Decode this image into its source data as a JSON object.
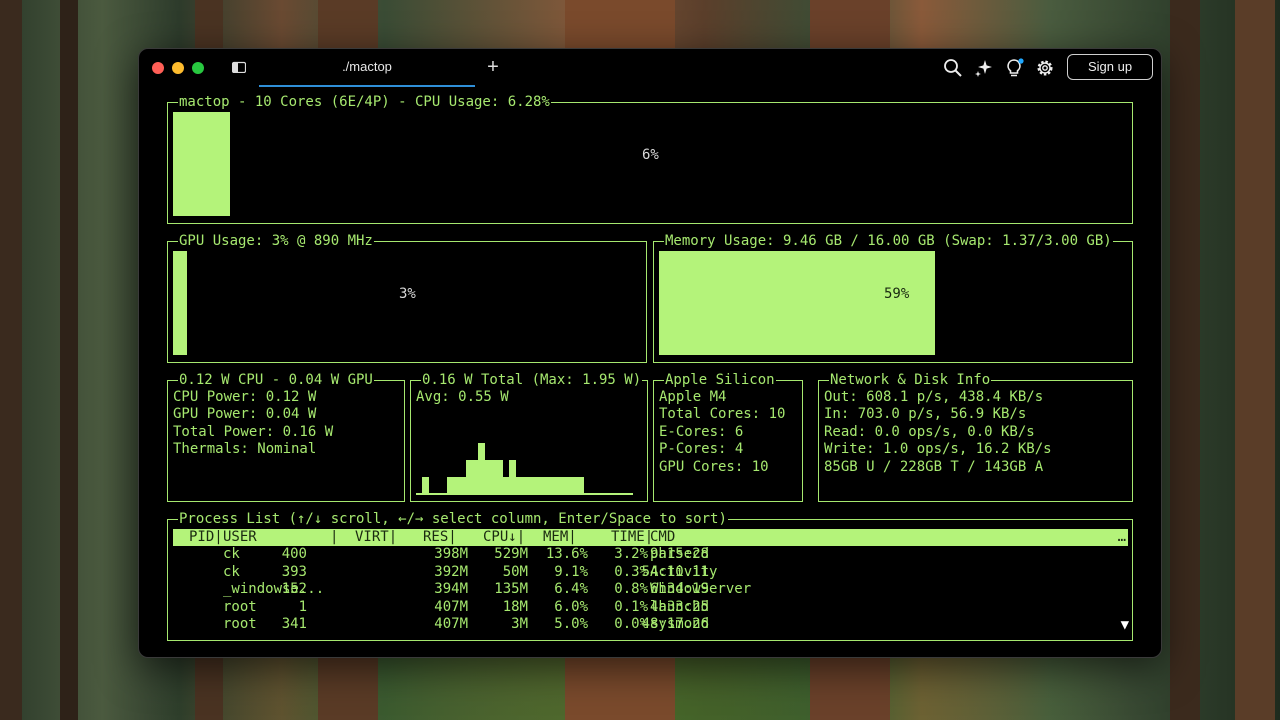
{
  "window": {
    "tab_title": "./mactop",
    "new_tab_label": "+",
    "signup_label": "Sign up",
    "icons": [
      "sidebar-toggle-icon",
      "search-icon",
      "sparkle-icon",
      "lightbulb-icon",
      "gear-icon"
    ],
    "colors": {
      "accent": "#a6e86f",
      "bar_fill": "#b4f37a",
      "tab_underline": "#2f8fd8",
      "notification_dot": "#1ea7ff"
    }
  },
  "cpu": {
    "title": "mactop - 10 Cores (6E/4P) - CPU Usage: 6.28%",
    "percent_label": "6%",
    "level": 0.06
  },
  "gpu": {
    "title": "GPU Usage: 3% @ 890 MHz",
    "percent_label": "3%",
    "level": 0.03
  },
  "memory": {
    "title": "Memory Usage: 9.46 GB / 16.00 GB (Swap: 1.37/3.00 GB)",
    "percent_label": "59%",
    "level": 0.59
  },
  "power": {
    "title": "0.12 W CPU - 0.04 W GPU",
    "lines": [
      "CPU Power: 0.12 W",
      "GPU Power: 0.04 W",
      "Total Power: 0.16 W",
      "Thermals: Nominal"
    ]
  },
  "power_chart": {
    "title": "0.16 W Total (Max: 1.95 W)",
    "avg_label": "Avg: 0.55 W",
    "levels": [
      0.0,
      0.33,
      0.0,
      0.0,
      0.0,
      0.33,
      0.33,
      0.33,
      0.67,
      0.67,
      1.0,
      0.67,
      0.67,
      0.67,
      0.33,
      0.67,
      0.33,
      0.33,
      0.33,
      0.33,
      0.33,
      0.33,
      0.33,
      0.33,
      0.33,
      0.33,
      0.33,
      0.0,
      0.0,
      0.0,
      0.0,
      0.0,
      0.0,
      0.0,
      0.0
    ]
  },
  "silicon": {
    "title": "Apple Silicon",
    "lines": [
      "Apple M4",
      "Total Cores: 10",
      "E-Cores: 6",
      "P-Cores: 4",
      "GPU Cores: 10"
    ]
  },
  "network": {
    "title": "Network & Disk Info",
    "lines": [
      "Out: 608.1 p/s, 438.4 KB/s",
      "In: 703.0 p/s, 56.9 KB/s",
      "Read: 0.0 ops/s, 0.0 KB/s",
      "Write: 1.0 ops/s, 16.2 KB/s",
      "85GB U / 228GB T / 143GB A"
    ]
  },
  "process_list": {
    "title": "Process List (↑/↓ scroll, ←/→ select column, Enter/Space to sort)",
    "header": [
      "PID|",
      "USER",
      "|",
      "VIRT|",
      "RES|",
      "CPU↓|",
      "MEM|",
      "TIME|",
      "CMD"
    ],
    "header_overflow": "…",
    "rows": [
      [
        "400",
        "ck",
        "398M",
        "529M",
        "13.6%",
        "3.2%",
        "9h15:28",
        "parsecd"
      ],
      [
        "393",
        "ck",
        "392M",
        "50M",
        "9.1%",
        "0.3%",
        "54:10.11",
        "Activity"
      ],
      [
        "152",
        "_windowse...",
        "394M",
        "135M",
        "6.4%",
        "0.8%",
        "6h34:19",
        "WindowServer"
      ],
      [
        "1",
        "root",
        "407M",
        "18M",
        "6.0%",
        "0.1%",
        "4h33:25",
        "launchd"
      ],
      [
        "341",
        "root",
        "407M",
        "3M",
        "5.0%",
        "0.0%",
        "48:17.26",
        "sysmond"
      ]
    ],
    "scroll_indicator": "▼"
  }
}
